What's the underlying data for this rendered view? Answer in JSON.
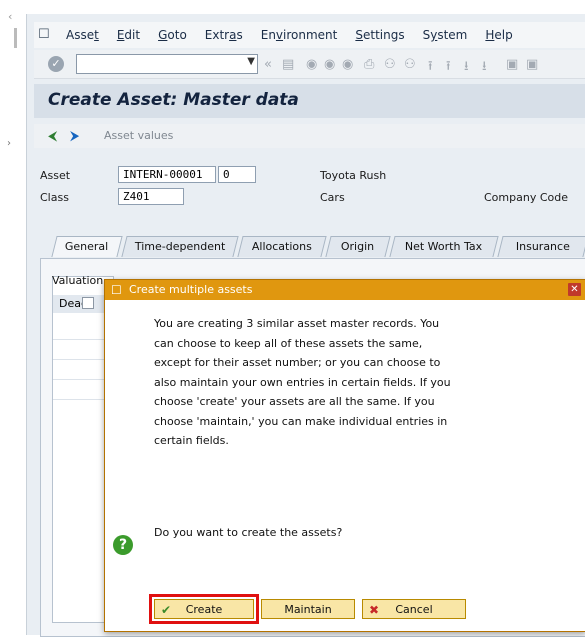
{
  "menu": {
    "items": [
      {
        "pre": "Asse",
        "u": "t",
        "post": ""
      },
      {
        "pre": "",
        "u": "E",
        "post": "dit"
      },
      {
        "pre": "",
        "u": "G",
        "post": "oto"
      },
      {
        "pre": "Extr",
        "u": "a",
        "post": "s"
      },
      {
        "pre": "En",
        "u": "v",
        "post": "ironment"
      },
      {
        "pre": "",
        "u": "S",
        "post": "ettings"
      },
      {
        "pre": "S",
        "u": "y",
        "post": "stem"
      },
      {
        "pre": "",
        "u": "H",
        "post": "elp"
      }
    ]
  },
  "page": {
    "title": "Create Asset:  Master data",
    "asset_values_label": "Asset values"
  },
  "header": {
    "asset_label": "Asset",
    "asset_number": "INTERN-00001",
    "asset_sub": "0",
    "asset_desc": "Toyota Rush",
    "class_label": "Class",
    "class_value": "Z401",
    "class_desc": "Cars",
    "company_code_label": "Company Code"
  },
  "tabs": [
    "General",
    "Time-dependent",
    "Allocations",
    "Origin",
    "Net Worth Tax",
    "Insurance"
  ],
  "grid": {
    "valuation_label": "Valuation",
    "column_deact": "Deact"
  },
  "dialog": {
    "title": "Create multiple assets",
    "message": "You are creating 3 similar asset master records. You can choose to keep all of these assets the same, except for their asset number; or you can choose to also maintain your own entries in certain fields. If you choose 'create' your assets are all the same. If you choose 'maintain,' you can make individual entries in certain fields.",
    "question": "Do you want to create the assets?",
    "buttons": {
      "create": "Create",
      "maintain": "Maintain",
      "cancel": "Cancel"
    }
  },
  "colors": {
    "dialog_title": "#e0970f",
    "button": "#f9e6a6",
    "highlight": "#e01010"
  }
}
